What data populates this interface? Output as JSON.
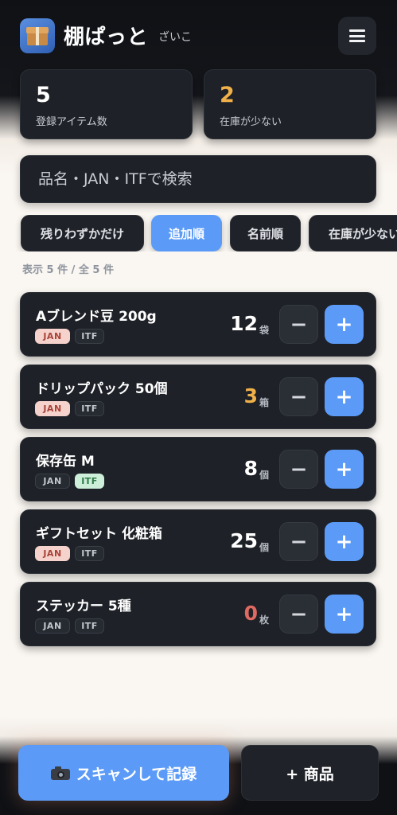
{
  "header": {
    "title": "棚ぱっと",
    "subtitle": "ざいこ",
    "logo_icon": "package-box-icon",
    "menu_icon": "hamburger-menu-icon"
  },
  "stats": {
    "registered_count": "5",
    "registered_label": "登録アイテム数",
    "low_stock_count": "2",
    "low_stock_label": "在庫が少ない"
  },
  "search": {
    "placeholder": "品名・JAN・ITFで検索"
  },
  "filters": [
    {
      "label": "残りわずかだけ",
      "active": false
    },
    {
      "label": "追加順",
      "active": true
    },
    {
      "label": "名前順",
      "active": false
    },
    {
      "label": "在庫が少ない",
      "active": false
    }
  ],
  "count_text": "表示 5 件 / 全 5 件",
  "items": [
    {
      "name": "Aブレンド豆 200g",
      "jan": "JAN",
      "itf": "ITF",
      "jan_on": true,
      "itf_on": false,
      "qty": "12",
      "unit": "袋",
      "qty_color": "#ffffff"
    },
    {
      "name": "ドリップパック 50個",
      "jan": "JAN",
      "itf": "ITF",
      "jan_on": true,
      "itf_on": false,
      "qty": "3",
      "unit": "箱",
      "qty_color": "#f0b14a"
    },
    {
      "name": "保存缶 M",
      "jan": "JAN",
      "itf": "ITF",
      "jan_on": false,
      "itf_on": true,
      "qty": "8",
      "unit": "個",
      "qty_color": "#ffffff"
    },
    {
      "name": "ギフトセット 化粧箱",
      "jan": "JAN",
      "itf": "ITF",
      "jan_on": true,
      "itf_on": false,
      "qty": "25",
      "unit": "個",
      "qty_color": "#ffffff"
    },
    {
      "name": "ステッカー 5種",
      "jan": "JAN",
      "itf": "ITF",
      "jan_on": false,
      "itf_on": false,
      "qty": "0",
      "unit": "枚",
      "qty_color": "#e06a62"
    }
  ],
  "buttons": {
    "minus": "−",
    "plus": "+"
  },
  "footer": {
    "scan_label": "スキャンして記録",
    "scan_icon": "camera-icon",
    "add_label": "+ 商品"
  },
  "colors": {
    "accent": "#5b9bf7",
    "warning": "#f0b14a",
    "danger": "#e06a62",
    "card": "#1e2127"
  }
}
